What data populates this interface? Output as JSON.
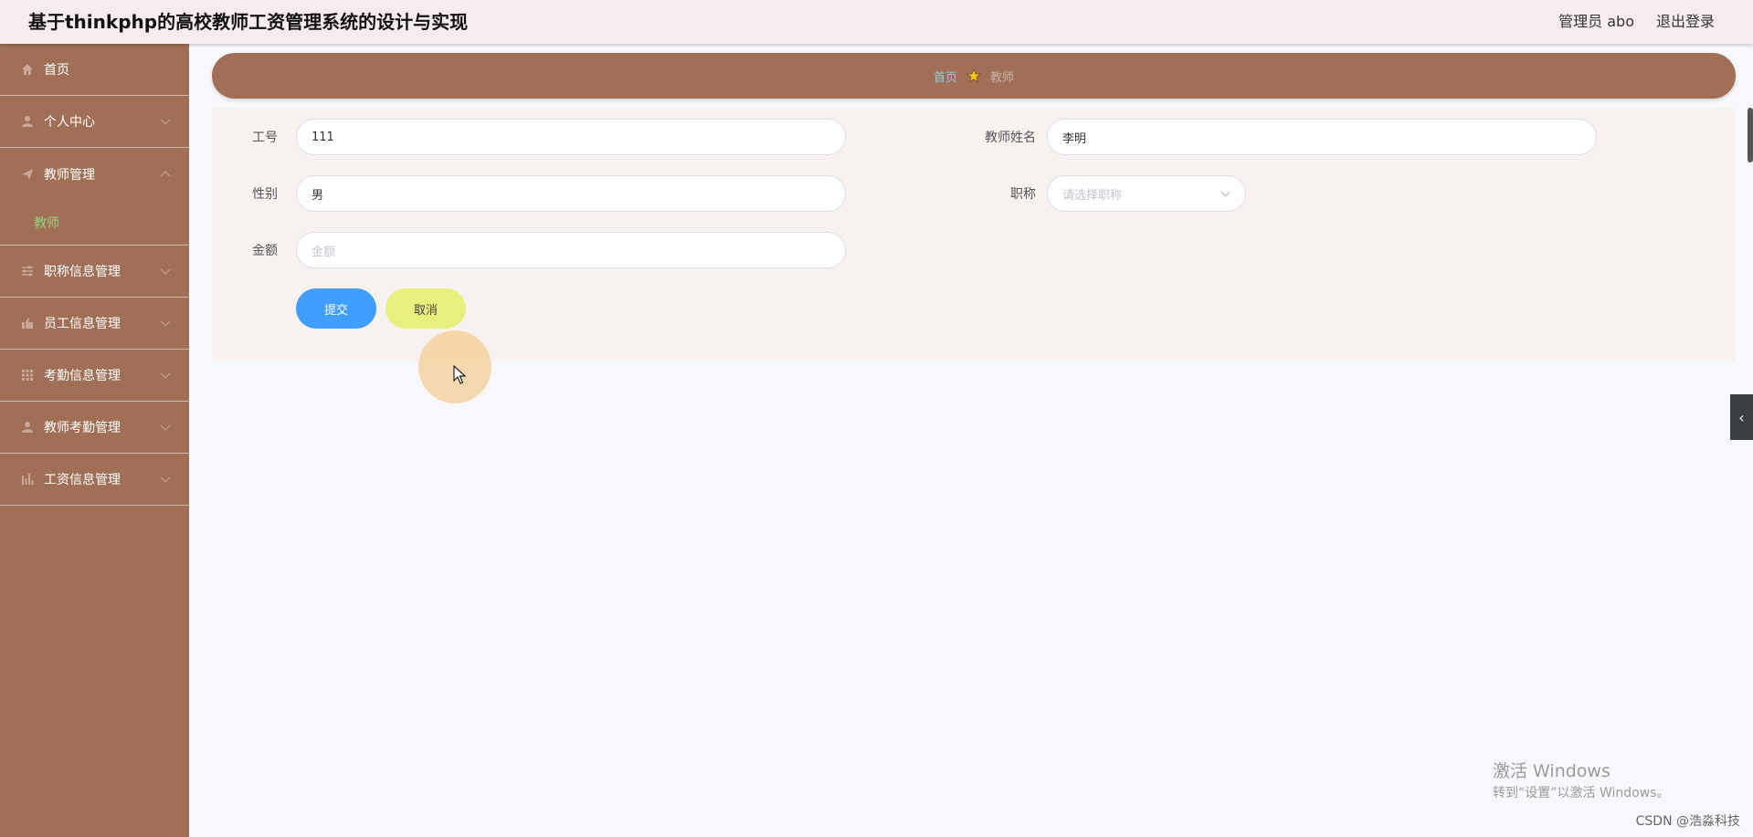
{
  "header": {
    "title": "基于thinkphp的高校教师工资管理系统的设计与实现",
    "user": "管理员 abo",
    "logout": "退出登录"
  },
  "sidebar": {
    "items": [
      {
        "label": "首页",
        "icon": "home-icon"
      },
      {
        "label": "个人中心",
        "icon": "user-icon"
      },
      {
        "label": "教师管理",
        "icon": "send-icon"
      },
      {
        "label": "职称信息管理",
        "icon": "sliders-icon"
      },
      {
        "label": "员工信息管理",
        "icon": "thumb-icon"
      },
      {
        "label": "考勤信息管理",
        "icon": "grid-icon"
      },
      {
        "label": "教师考勤管理",
        "icon": "person-icon"
      },
      {
        "label": "工资信息管理",
        "icon": "bar-chart-icon"
      }
    ],
    "sub_teacher": "教师"
  },
  "breadcrumb": {
    "home": "首页",
    "current": "教师"
  },
  "form": {
    "job_no_label": "工号",
    "job_no_value": "111",
    "name_label": "教师姓名",
    "name_value": "李明",
    "gender_label": "性别",
    "gender_value": "男",
    "title_label": "职称",
    "title_placeholder": "请选择职称",
    "amount_label": "金额",
    "amount_placeholder": "金额",
    "submit": "提交",
    "cancel": "取消"
  },
  "watermark": {
    "line1": "激活 Windows",
    "line2": "转到“设置”以激活 Windows。",
    "csdn": "CSDN @浩淼科技"
  },
  "colors": {
    "sidebar_bg": "#a06f56",
    "header_bg": "#f6ecee",
    "submit_btn": "#409eff",
    "cancel_btn": "#e8ef7c",
    "active_sub": "#8fd57e"
  }
}
